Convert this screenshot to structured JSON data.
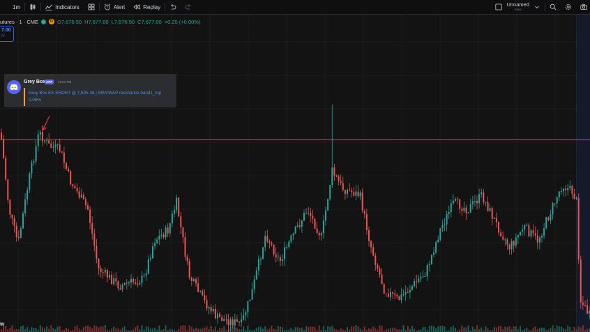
{
  "toolbar": {
    "interval": "1m",
    "indicators_label": "Indicators",
    "alert_label": "Alert",
    "replay_label": "Replay",
    "layout_name": "Unnamed",
    "layout_status": "Save"
  },
  "legend": {
    "symbol": "utures · 1 · CME",
    "badge": "D",
    "o_key": "O",
    "o_val": "7,676.50",
    "h_key": "H",
    "h_val": "7,677.00",
    "l_key": "L",
    "l_val": "7,676.50",
    "c_key": "C",
    "c_val": "7,677.00",
    "change": "+0.25 (+0.00%)"
  },
  "price_box": {
    "value": "7.00",
    "label": "IV"
  },
  "message": {
    "author": "Grey Box",
    "badge": "APP",
    "time": "12:23 PM",
    "line1": "Grey Box ES SHORT @ 7,605.38 | SR/VWAP resistance band1_top",
    "line2": "0.06%"
  },
  "bottom_label": "w",
  "colors": {
    "up": "#26a69a",
    "down": "#ef5350",
    "resistance_line": "#f23645",
    "background": "#131313",
    "discord_blurple": "#5865f2"
  },
  "icons": [
    "candles-icon",
    "indicators-icon",
    "templates-icon",
    "alert-icon",
    "replay-icon",
    "undo-icon",
    "redo-icon",
    "layout-icon",
    "chevron-down-icon",
    "search-icon",
    "settings-icon",
    "camera-icon",
    "discord-icon",
    "arrow-annotation"
  ]
}
